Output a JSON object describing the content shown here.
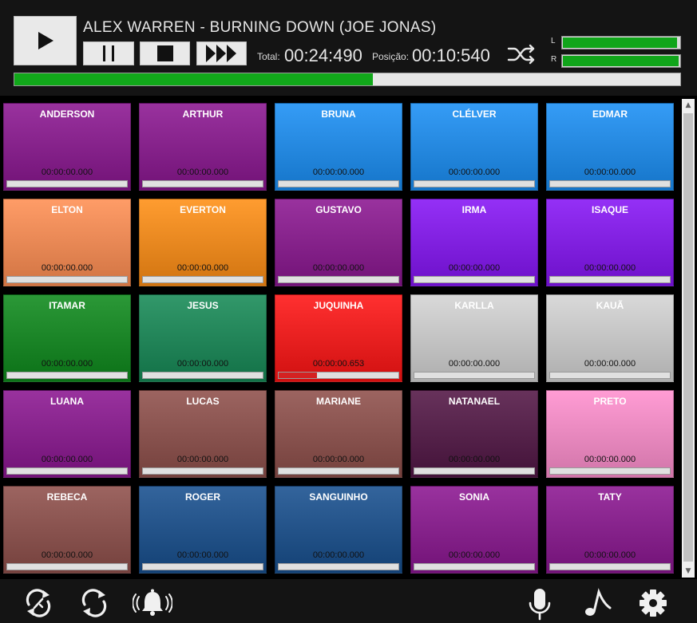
{
  "player": {
    "title": "ALEX WARREN - BURNING DOWN (JOE JONAS)",
    "total_label": "Total:",
    "total_time": "00:24:490",
    "position_label": "Posição:",
    "position_time": "00:10:540",
    "progress": 0.538,
    "vu_left_label": "L",
    "vu_right_label": "R",
    "vu_left_level": 0.98,
    "vu_right_level": 0.99,
    "icons": {
      "play": "play-icon",
      "pause": "pause-icon",
      "stop": "stop-icon",
      "next": "fast-forward-icon",
      "shuffle": "shuffle-icon"
    }
  },
  "pads": [
    {
      "name": "ANDERSON",
      "time": "00:00:00.000",
      "color": "#8b1691",
      "progress": 0
    },
    {
      "name": "ARTHUR",
      "time": "00:00:00.000",
      "color": "#8b1691",
      "progress": 0
    },
    {
      "name": "BRUNA",
      "time": "00:00:00.000",
      "color": "#1a8ff5",
      "progress": 0
    },
    {
      "name": "CLÉLVER",
      "time": "00:00:00.000",
      "color": "#1a8ff5",
      "progress": 0
    },
    {
      "name": "EDMAR",
      "time": "00:00:00.000",
      "color": "#1a8ff5",
      "progress": 0
    },
    {
      "name": "ELTON",
      "time": "00:00:00.000",
      "color": "#ff8e52",
      "progress": 0
    },
    {
      "name": "EVERTON",
      "time": "00:00:00.000",
      "color": "#ff8e14",
      "progress": 0
    },
    {
      "name": "GUSTAVO",
      "time": "00:00:00.000",
      "color": "#8b1691",
      "progress": 0
    },
    {
      "name": "IRMA",
      "time": "00:00:00.000",
      "color": "#8514f5",
      "progress": 0
    },
    {
      "name": "ISAQUE",
      "time": "00:00:00.000",
      "color": "#8514f5",
      "progress": 0
    },
    {
      "name": "ITAMAR",
      "time": "00:00:00.000",
      "color": "#0e8a1c",
      "progress": 0
    },
    {
      "name": "JESUS",
      "time": "00:00:00.000",
      "color": "#168a56",
      "progress": 0
    },
    {
      "name": "JUQUINHA",
      "time": "00:00:00.653",
      "color": "#ff1414",
      "progress": 0.32
    },
    {
      "name": "KARLLA",
      "time": "00:00:00.000",
      "color": "#d4d4d4",
      "progress": 0
    },
    {
      "name": "KAUÃ",
      "time": "00:00:00.000",
      "color": "#d4d4d4",
      "progress": 0
    },
    {
      "name": "LUANA",
      "time": "00:00:00.000",
      "color": "#8b1691",
      "progress": 0
    },
    {
      "name": "LUCAS",
      "time": "00:00:00.000",
      "color": "#8f4f4a",
      "progress": 0
    },
    {
      "name": "MARIANE",
      "time": "00:00:00.000",
      "color": "#8f4f4a",
      "progress": 0
    },
    {
      "name": "NATANAEL",
      "time": "00:00:00.000",
      "color": "#521645",
      "progress": 0
    },
    {
      "name": "PRETO",
      "time": "00:00:00.000",
      "color": "#ff8fce",
      "progress": 0
    },
    {
      "name": "REBECA",
      "time": "00:00:00.000",
      "color": "#8f4f4a",
      "progress": 0
    },
    {
      "name": "ROGER",
      "time": "00:00:00.000",
      "color": "#174f8f",
      "progress": 0
    },
    {
      "name": "SANGUINHO",
      "time": "00:00:00.000",
      "color": "#174f8f",
      "progress": 0
    },
    {
      "name": "SONIA",
      "time": "00:00:00.000",
      "color": "#8b1691",
      "progress": 0
    },
    {
      "name": "TATY",
      "time": "00:00:00.000",
      "color": "#8b1691",
      "progress": 0
    }
  ],
  "footer": {
    "icons": [
      "repeat-all-icon",
      "refresh-icon",
      "bell-icon",
      "microphone-icon",
      "music-note-icon",
      "gear-icon"
    ]
  }
}
